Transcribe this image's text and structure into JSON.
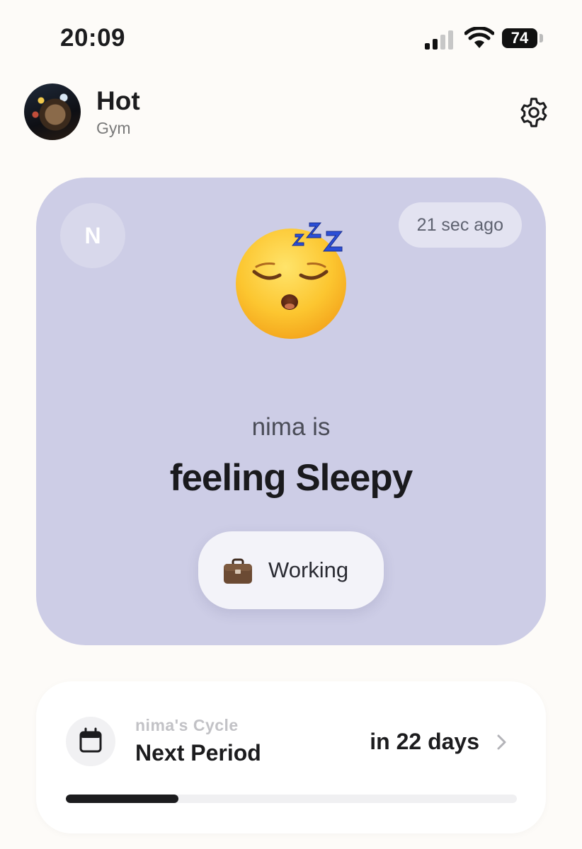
{
  "status_bar": {
    "time": "20:09",
    "battery": "74"
  },
  "profile": {
    "name": "Hot",
    "subtitle": "Gym",
    "avatar": "user-photo"
  },
  "mood_card": {
    "initial": "N",
    "time_ago": "21 sec ago",
    "emoji_icon": "sleeping-face-icon",
    "line1": "nima is",
    "line2": "feeling Sleepy",
    "activity": {
      "icon": "briefcase-icon",
      "label": "Working"
    },
    "background_color": "#cdcde6"
  },
  "cycle_card": {
    "owner_label": "nima's Cycle",
    "title": "Next Period",
    "countdown": "in 22 days",
    "progress": 0.25,
    "icon": "calendar-icon"
  }
}
